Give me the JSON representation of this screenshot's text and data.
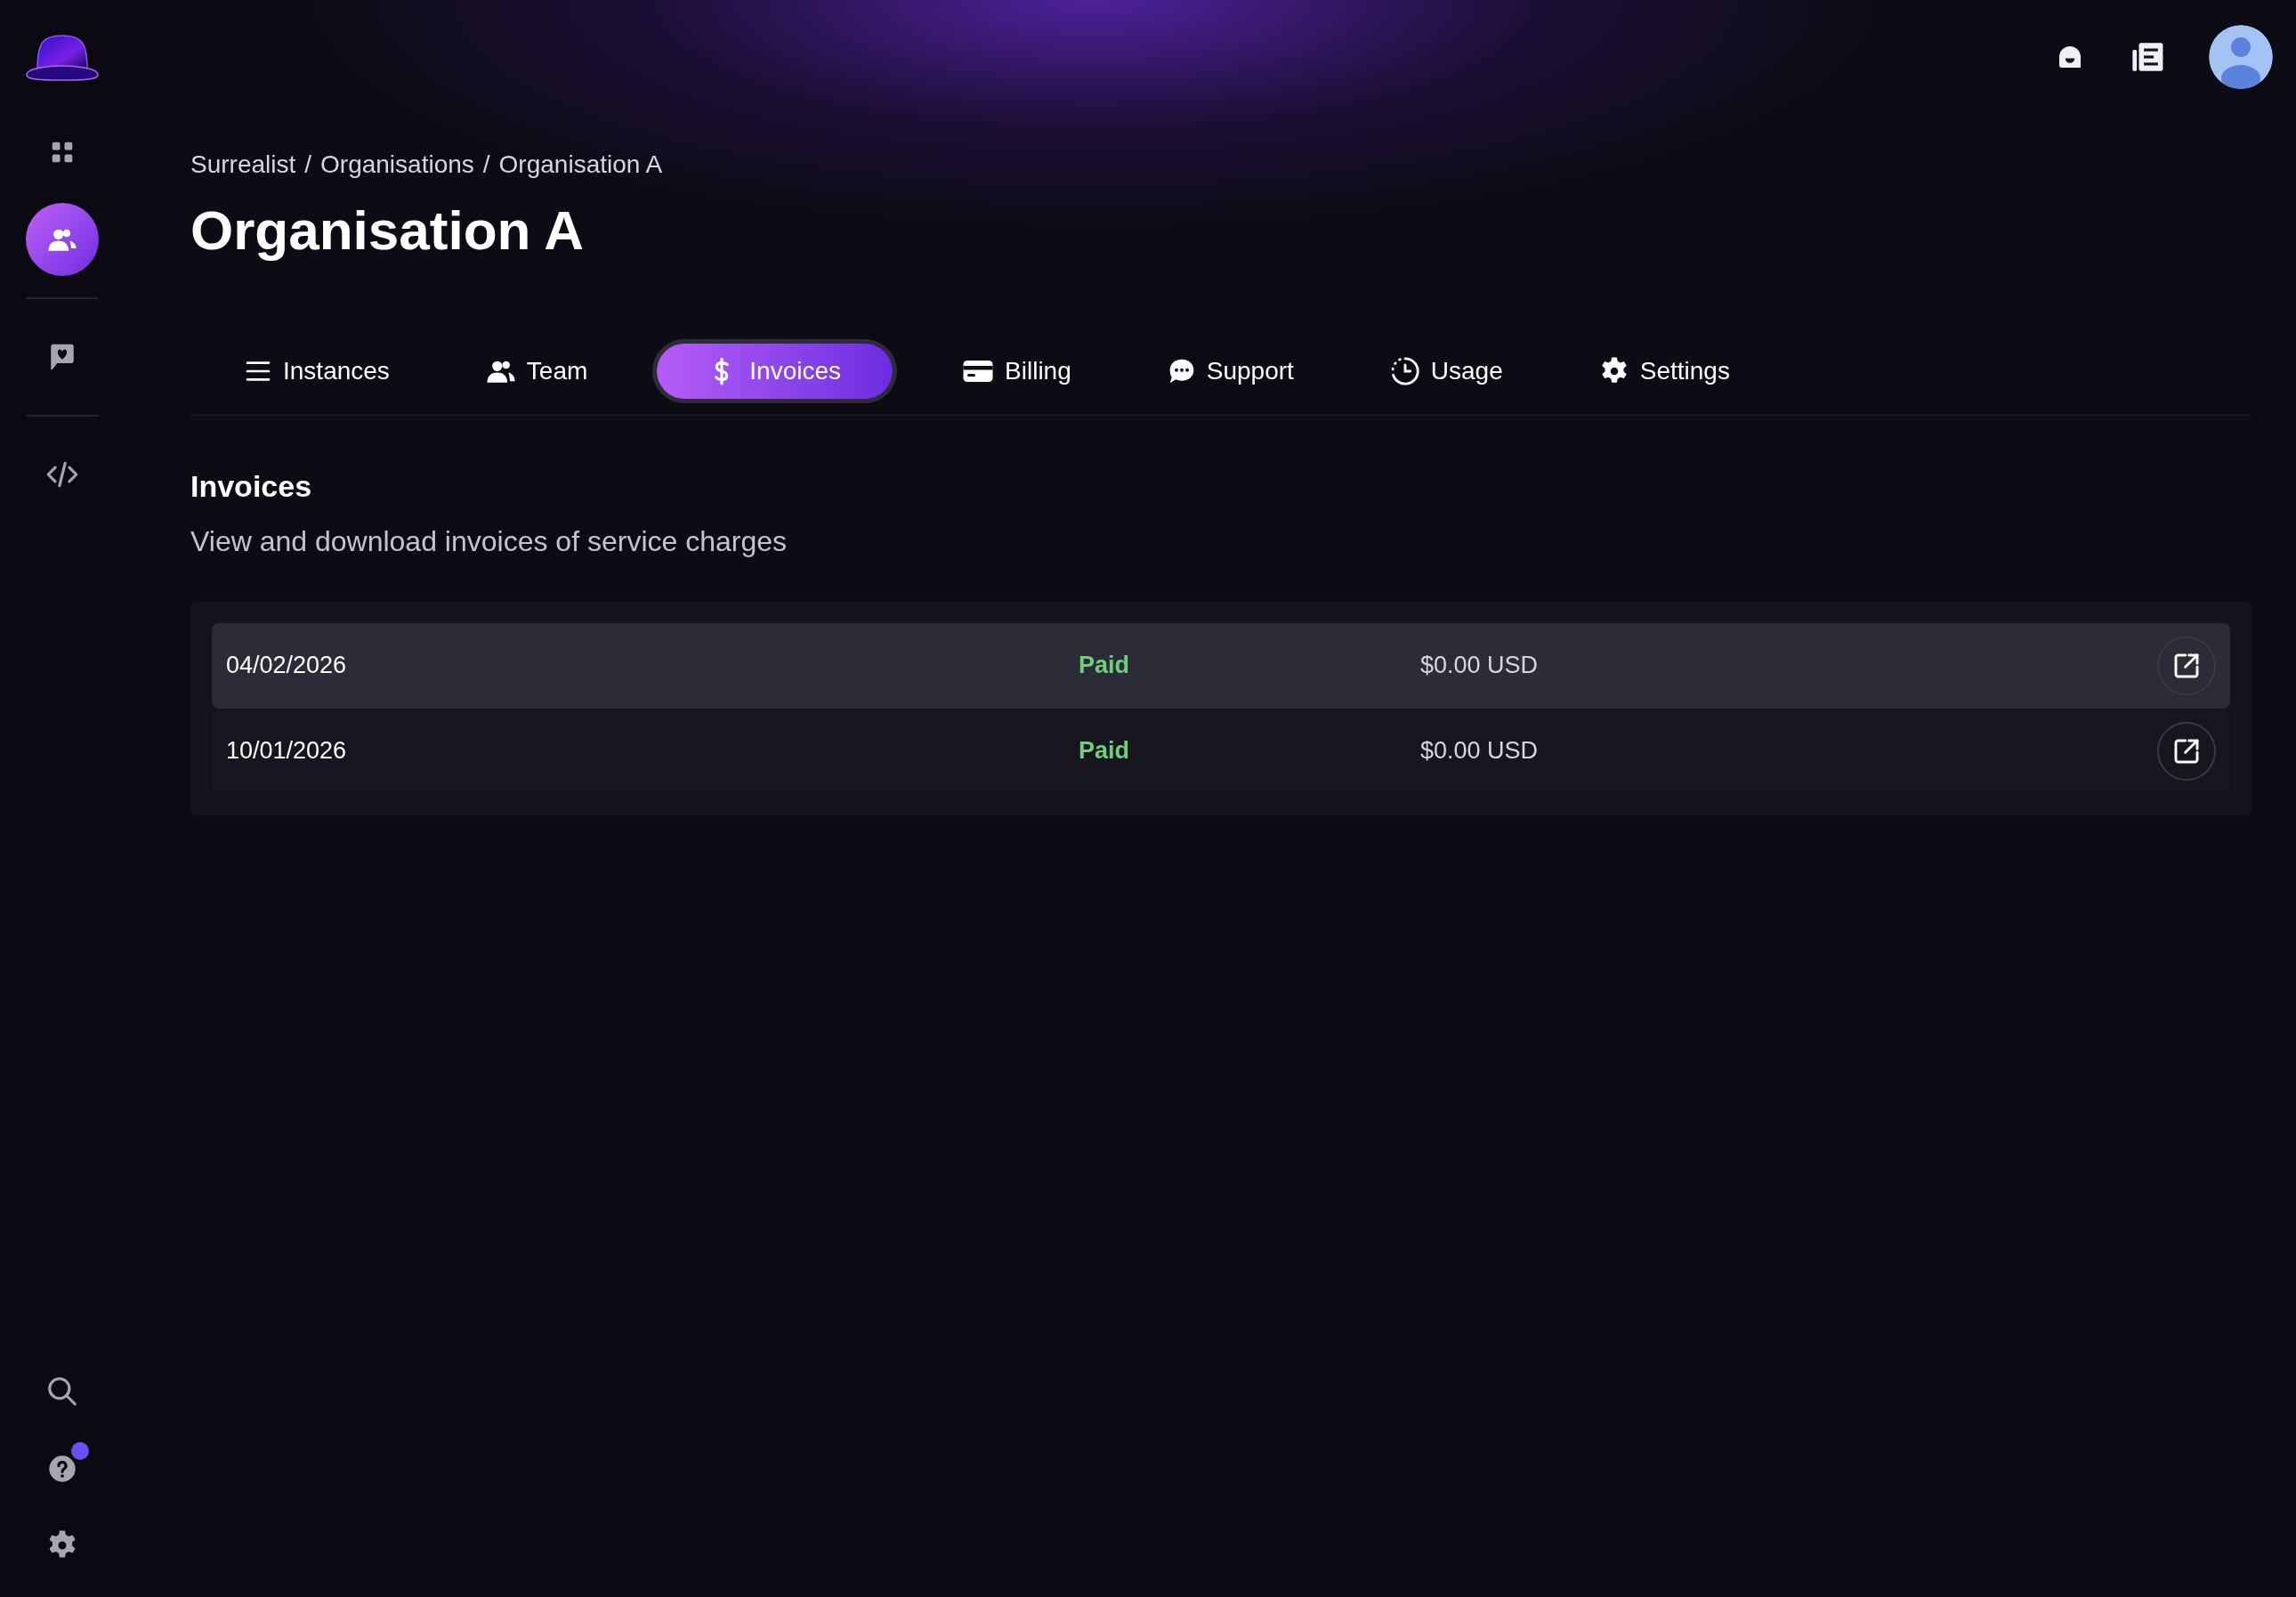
{
  "sidebar": {
    "nav_items": [
      {
        "selected": false
      },
      {
        "selected": true
      },
      {
        "selected": false
      },
      {
        "selected": false
      }
    ],
    "bottom_items": [
      {
        "badge": false
      },
      {
        "badge": true
      },
      {
        "badge": false
      }
    ]
  },
  "breadcrumb": [
    "Surrealist",
    "Organisations",
    "Organisation A"
  ],
  "breadcrumb_separator": "/",
  "title": "Organisation A",
  "tabs": [
    {
      "label": "Instances",
      "selected": false
    },
    {
      "label": "Team",
      "selected": false
    },
    {
      "label": "Invoices",
      "selected": true
    },
    {
      "label": "Billing",
      "selected": false
    },
    {
      "label": "Support",
      "selected": false
    },
    {
      "label": "Usage",
      "selected": false
    },
    {
      "label": "Settings",
      "selected": false
    }
  ],
  "section": {
    "heading": "Invoices",
    "description": "View and download invoices of service charges"
  },
  "invoices": [
    {
      "date": "04/02/2026",
      "status": "Paid",
      "amount": "$0.00 USD",
      "highlighted": true
    },
    {
      "date": "10/01/2026",
      "status": "Paid",
      "amount": "$0.00 USD",
      "highlighted": false
    }
  ]
}
